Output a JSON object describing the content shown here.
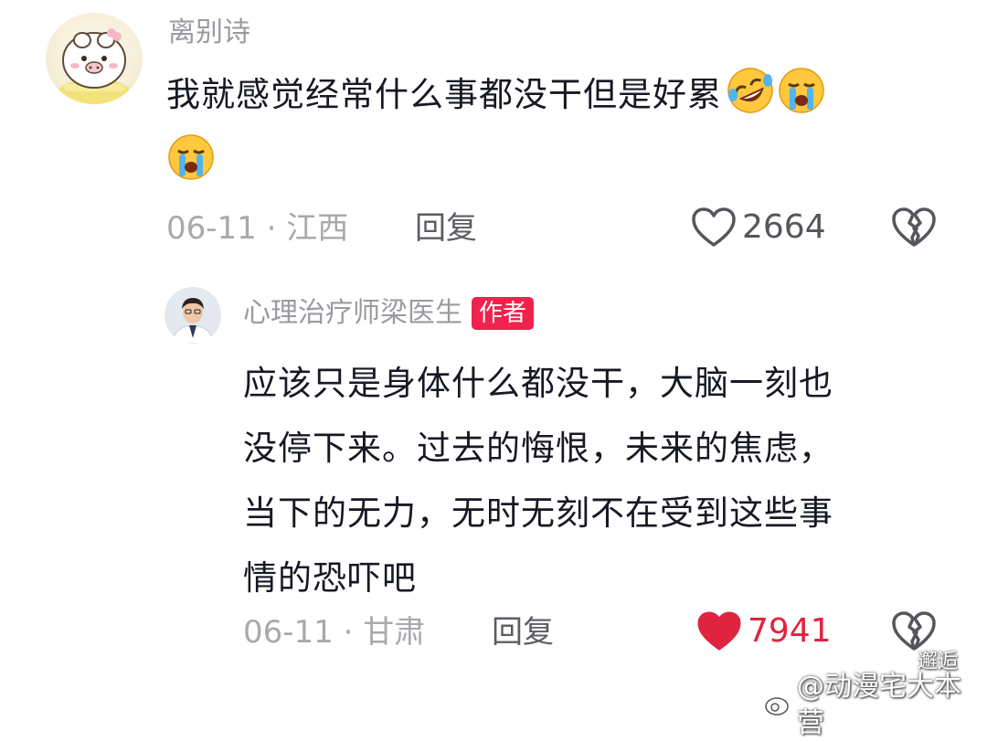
{
  "comment": {
    "username": "离别诗",
    "text": "我就感觉经常什么事都没干但是好累",
    "date": "06-11",
    "separator": "·",
    "location": "江西",
    "reply_label": "回复",
    "likes": "2664",
    "liked": false
  },
  "reply": {
    "username": "心理治疗师梁医生",
    "badge": "作者",
    "lines": [
      "应该只是身体什么都没干，大脑一刻也",
      "没停下来。过去的悔恨，未来的焦虑，",
      "当下的无力，无时无刻不在受到这些事",
      "情的恐吓吧"
    ],
    "date": "06-11",
    "separator": "·",
    "location": "甘肃",
    "reply_label": "回复",
    "likes": "7941",
    "liked": true
  },
  "watermark": {
    "top": "邂逅",
    "bottom": "@动漫宅大本营"
  },
  "icons": {
    "emoji_1": "rolling-laughing-emoji",
    "emoji_2": "crying-emoji",
    "like": "heart-icon",
    "dislike": "broken-heart-icon"
  },
  "colors": {
    "like_active": "#e0243f",
    "author_badge": "#f1224e",
    "muted_text": "#a8a8ad"
  }
}
